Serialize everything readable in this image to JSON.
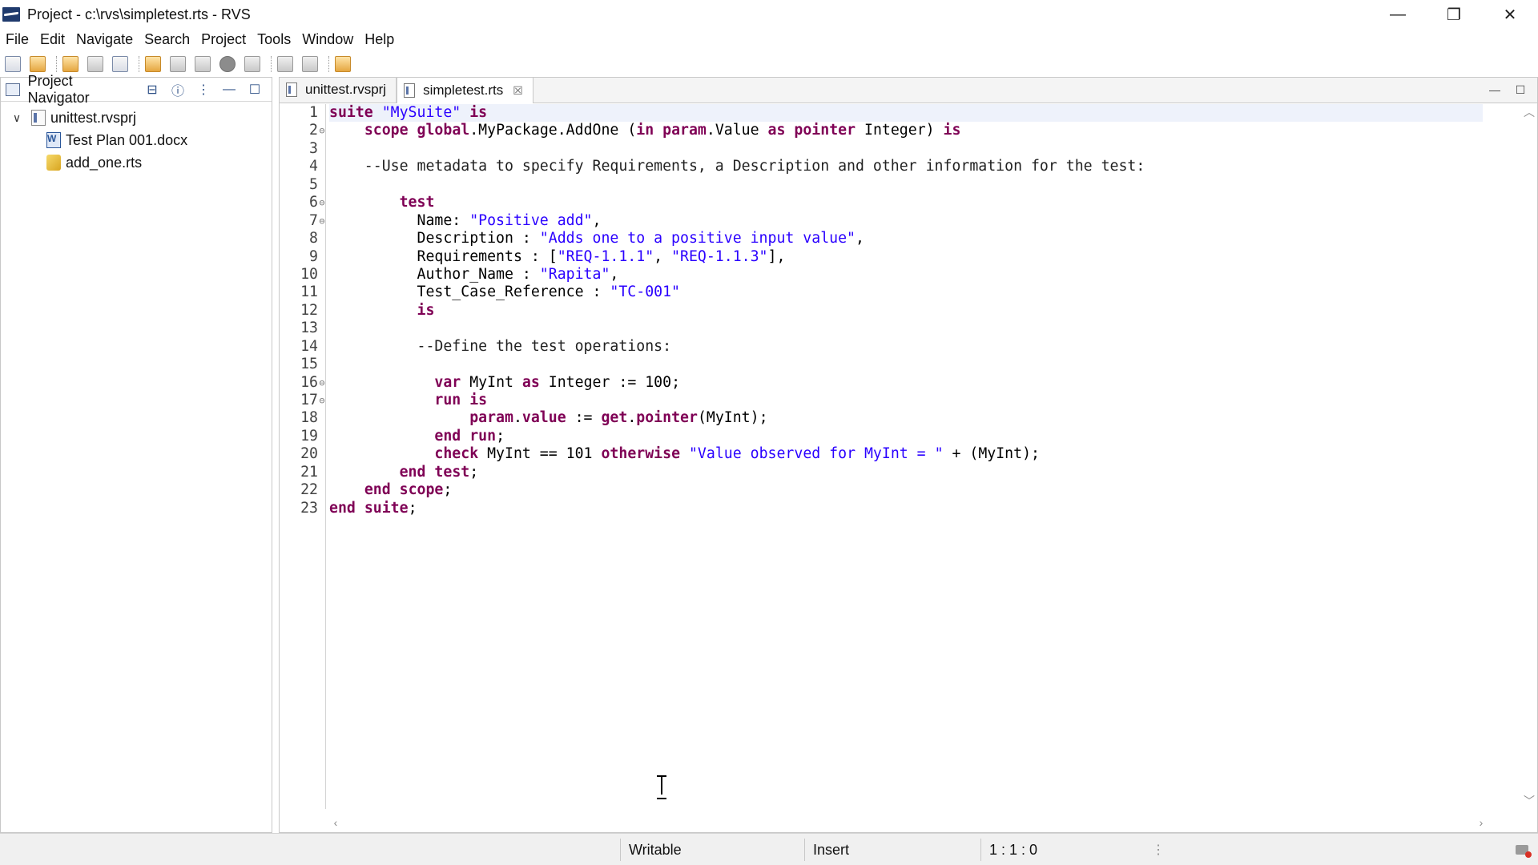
{
  "window": {
    "title": "Project - c:\\rvs\\simpletest.rts - RVS",
    "controls": {
      "minimize": "—",
      "restore": "❐",
      "close": "✕"
    }
  },
  "menu": [
    "File",
    "Edit",
    "Navigate",
    "Search",
    "Project",
    "Tools",
    "Window",
    "Help"
  ],
  "toolbar": {
    "buttons": [
      "new-project-icon",
      "new-file-icon",
      "open-icon",
      "save-icon",
      "print-icon",
      "export-icon",
      "build-icon",
      "run-gear-icon",
      "run-icon",
      "step-icon",
      "import-icon",
      "report-icon",
      "pen-icon"
    ]
  },
  "navigator": {
    "title": "Project Navigator",
    "tree": [
      {
        "label": "unittest.rvsprj",
        "expanded": true,
        "icon": "project-file-icon",
        "level": 0
      },
      {
        "label": "Test Plan 001.docx",
        "icon": "word-document-icon",
        "level": 1
      },
      {
        "label": "add_one.rts",
        "icon": "rts-file-icon",
        "level": 1
      }
    ]
  },
  "editor": {
    "tabs": [
      {
        "label": "unittest.rvsprj",
        "active": false
      },
      {
        "label": "simpletest.rts",
        "active": true,
        "close": "☒"
      }
    ],
    "line_numbers": [
      "1",
      "2",
      "3",
      "4",
      "5",
      "6",
      "7",
      "8",
      "9",
      "10",
      "11",
      "12",
      "13",
      "14",
      "15",
      "16",
      "17",
      "18",
      "19",
      "20",
      "21",
      "22",
      "23"
    ],
    "folds": [
      "",
      "⊖",
      "",
      "",
      "",
      "⊖",
      "⊖",
      "",
      "",
      "",
      "",
      "",
      "",
      "",
      "",
      "⊖",
      "⊖",
      "",
      "",
      "",
      "",
      "",
      ""
    ],
    "lines": [
      [
        {
          "t": "suite",
          "c": "kw"
        },
        {
          "t": " "
        },
        {
          "t": "\"MySuite\"",
          "c": "str"
        },
        {
          "t": " "
        },
        {
          "t": "is",
          "c": "kw"
        }
      ],
      [
        {
          "t": "    "
        },
        {
          "t": "scope",
          "c": "kw"
        },
        {
          "t": " "
        },
        {
          "t": "global",
          "c": "kw"
        },
        {
          "t": ".MyPackage.AddOne ("
        },
        {
          "t": "in",
          "c": "kw"
        },
        {
          "t": " "
        },
        {
          "t": "param",
          "c": "kw"
        },
        {
          "t": ".Value "
        },
        {
          "t": "as",
          "c": "kw"
        },
        {
          "t": " "
        },
        {
          "t": "pointer",
          "c": "kw"
        },
        {
          "t": " Integer) "
        },
        {
          "t": "is",
          "c": "kw"
        }
      ],
      [
        {
          "t": ""
        }
      ],
      [
        {
          "t": "    --Use metadata to specify Requirements, a Description and other information for the test:",
          "c": "cmt"
        }
      ],
      [
        {
          "t": ""
        }
      ],
      [
        {
          "t": "        "
        },
        {
          "t": "test",
          "c": "kw"
        }
      ],
      [
        {
          "t": "          Name: "
        },
        {
          "t": "\"Positive add\"",
          "c": "str"
        },
        {
          "t": ","
        }
      ],
      [
        {
          "t": "          Description : "
        },
        {
          "t": "\"Adds one to a positive input value\"",
          "c": "str"
        },
        {
          "t": ","
        }
      ],
      [
        {
          "t": "          Requirements : ["
        },
        {
          "t": "\"REQ-1.1.1\"",
          "c": "str"
        },
        {
          "t": ", "
        },
        {
          "t": "\"REQ-1.1.3\"",
          "c": "str"
        },
        {
          "t": "],"
        }
      ],
      [
        {
          "t": "          Author_Name : "
        },
        {
          "t": "\"Rapita\"",
          "c": "str"
        },
        {
          "t": ","
        }
      ],
      [
        {
          "t": "          Test_Case_Reference : "
        },
        {
          "t": "\"TC-001\"",
          "c": "str"
        }
      ],
      [
        {
          "t": "          "
        },
        {
          "t": "is",
          "c": "kw"
        }
      ],
      [
        {
          "t": ""
        }
      ],
      [
        {
          "t": "          --Define the test operations:",
          "c": "cmt"
        }
      ],
      [
        {
          "t": ""
        }
      ],
      [
        {
          "t": "            "
        },
        {
          "t": "var",
          "c": "kw"
        },
        {
          "t": " MyInt "
        },
        {
          "t": "as",
          "c": "kw"
        },
        {
          "t": " Integer := 100;"
        }
      ],
      [
        {
          "t": "            "
        },
        {
          "t": "run",
          "c": "kw"
        },
        {
          "t": " "
        },
        {
          "t": "is",
          "c": "kw"
        }
      ],
      [
        {
          "t": "                "
        },
        {
          "t": "param",
          "c": "kw"
        },
        {
          "t": "."
        },
        {
          "t": "value",
          "c": "kw"
        },
        {
          "t": " := "
        },
        {
          "t": "get",
          "c": "kw"
        },
        {
          "t": "."
        },
        {
          "t": "pointer",
          "c": "kw"
        },
        {
          "t": "(MyInt);"
        }
      ],
      [
        {
          "t": "            "
        },
        {
          "t": "end",
          "c": "kw"
        },
        {
          "t": " "
        },
        {
          "t": "run",
          "c": "kw"
        },
        {
          "t": ";"
        }
      ],
      [
        {
          "t": "            "
        },
        {
          "t": "check",
          "c": "kw"
        },
        {
          "t": " MyInt == 101 "
        },
        {
          "t": "otherwise",
          "c": "kw"
        },
        {
          "t": " "
        },
        {
          "t": "\"Value observed for MyInt = \"",
          "c": "str"
        },
        {
          "t": " + (MyInt);"
        }
      ],
      [
        {
          "t": "        "
        },
        {
          "t": "end",
          "c": "kw"
        },
        {
          "t": " "
        },
        {
          "t": "test",
          "c": "kw"
        },
        {
          "t": ";"
        }
      ],
      [
        {
          "t": "    "
        },
        {
          "t": "end",
          "c": "kw"
        },
        {
          "t": " "
        },
        {
          "t": "scope",
          "c": "kw"
        },
        {
          "t": ";"
        }
      ],
      [
        {
          "t": "end",
          "c": "kw"
        },
        {
          "t": " "
        },
        {
          "t": "suite",
          "c": "kw"
        },
        {
          "t": ";"
        }
      ]
    ],
    "current_line": 1
  },
  "status": {
    "mode": "Writable",
    "insert": "Insert",
    "position": "1 : 1 : 0"
  },
  "colors": {
    "keyword": "#7f0055",
    "string": "#2a00ff",
    "current_line": "#eef2fb"
  }
}
